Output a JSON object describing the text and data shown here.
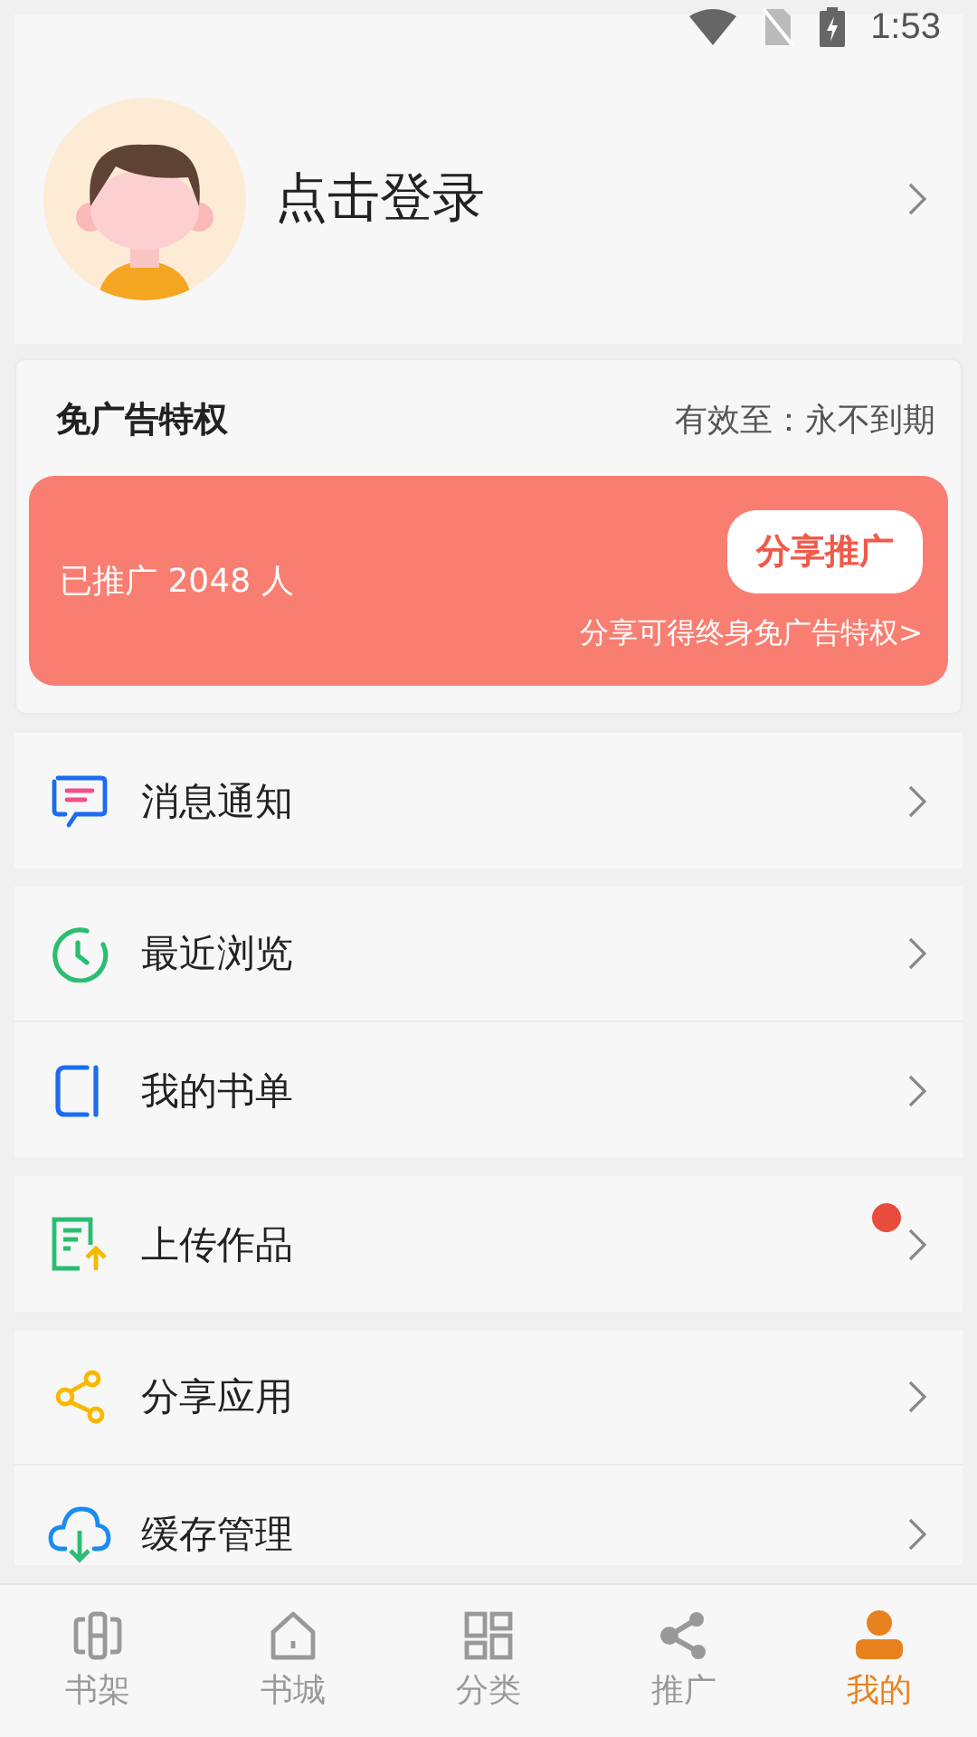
{
  "status_bar": {
    "time": "1:53"
  },
  "profile": {
    "login_label": "点击登录"
  },
  "vip": {
    "title": "免广告特权",
    "validity": "有效至：永不到期",
    "promoted": "已推广 2048 人",
    "share_button": "分享推广",
    "hint": "分享可得终身免广告特权>"
  },
  "menu_groups": [
    {
      "items": [
        {
          "kind": "message",
          "label": "消息通知",
          "badge": false
        }
      ]
    },
    {
      "items": [
        {
          "kind": "clock",
          "label": "最近浏览",
          "badge": false
        },
        {
          "kind": "booklist",
          "label": "我的书单",
          "badge": false
        }
      ]
    },
    {
      "items": [
        {
          "kind": "upload",
          "label": "上传作品",
          "badge": true
        }
      ]
    },
    {
      "items": [
        {
          "kind": "share",
          "label": "分享应用",
          "badge": false
        },
        {
          "kind": "cloud",
          "label": "缓存管理",
          "badge": false
        }
      ]
    }
  ],
  "nav": [
    {
      "kind": "shelf",
      "label": "书架",
      "selected": false
    },
    {
      "kind": "home",
      "label": "书城",
      "selected": false
    },
    {
      "kind": "grid",
      "label": "分类",
      "selected": false
    },
    {
      "kind": "share",
      "label": "推广",
      "selected": false
    },
    {
      "kind": "person",
      "label": "我的",
      "selected": true
    }
  ]
}
